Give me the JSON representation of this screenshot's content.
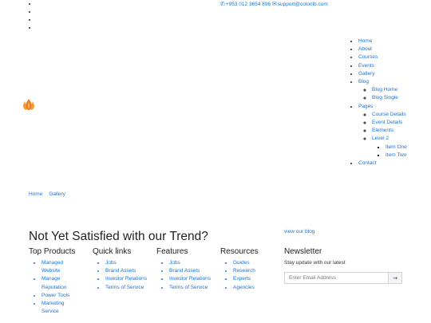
{
  "topbar": {
    "phone": "+953 012 3654 896",
    "email": "support@colorlib.com",
    "icons": [
      "phone-icon",
      "envelope-icon"
    ]
  },
  "logo": {
    "icon": "flame-logo-icon",
    "color": "#f07b16"
  },
  "nav": {
    "home": "Home",
    "about": "About",
    "courses": "Courses",
    "events": "Events",
    "gallery": "Gallery",
    "blog": "Blog",
    "blog_home": "Blog Home",
    "blog_single": "Blog Single",
    "pages": "Pages",
    "course_details": "Course Details",
    "event_details": "Event Details",
    "elements": "Elements",
    "level2": "Level 2",
    "item_one": "Item One",
    "item_two": "Item Two",
    "contact": "Contact"
  },
  "breadcrumb": {
    "home": "Home",
    "current": "Gallery"
  },
  "footer": {
    "cta": "Not Yet Satisfied with our Trend?",
    "blog_link": "view our blog",
    "columns": [
      {
        "title": "Top Products",
        "items": [
          "Managed Website",
          "Manage Reputation",
          "Power Tools",
          "Marketing Service"
        ]
      },
      {
        "title": "Quick links",
        "items": [
          "Jobs",
          "Brand Assets",
          "Investor Relations",
          "Terms of Service"
        ]
      },
      {
        "title": "Features",
        "items": [
          "Jobs",
          "Brand Assets",
          "Investor Relations",
          "Terms of Service"
        ]
      },
      {
        "title": "Resources",
        "items": [
          "Guides",
          "Research",
          "Experts",
          "Agencies"
        ]
      }
    ],
    "newsletter": {
      "title": "Newsletter",
      "text": "Stay update with our latest",
      "placeholder": "Enter Email Address",
      "submit_icon": "arrow-right-icon"
    }
  },
  "colors": {
    "link": "#1a73d9",
    "text": "#222222"
  }
}
